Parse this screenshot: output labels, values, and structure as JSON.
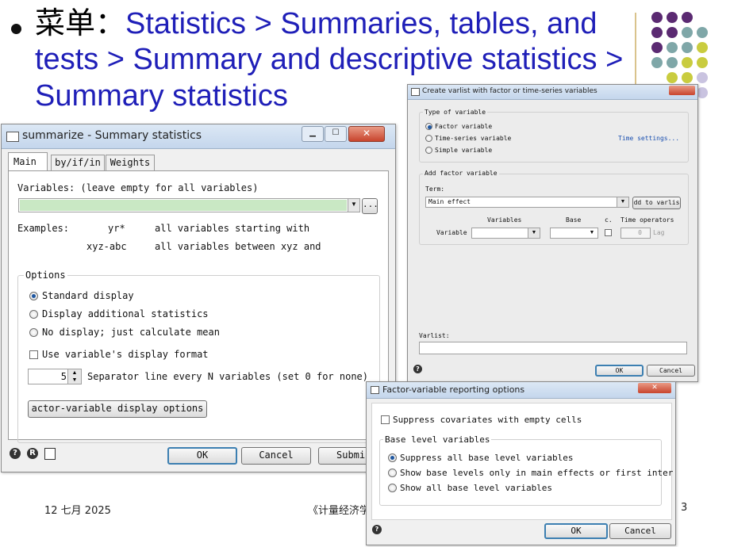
{
  "slide": {
    "title_prefix": "菜单：",
    "title_line1": "Statistics > Summaries, tables, and",
    "title_line2": "tests > Summary and descriptive statistics >",
    "title_line3": "Summary statistics",
    "footer_date": "12 七月 2025",
    "footer_center": "《计量经济学",
    "page_number": "3",
    "colors": {
      "title": "#1f1fb8",
      "dot_purple": "#5b2a72",
      "dot_teal": "#7fa7a8",
      "dot_yellow": "#c9cc3f",
      "dot_lavender": "#c9c3e0"
    }
  },
  "summarize": {
    "title": "summarize - Summary statistics",
    "tabs": [
      "Main",
      "by/if/in",
      "Weights"
    ],
    "variables_label": "Variables: (leave empty for all variables)",
    "browse_label": "...",
    "examples_label": "Examples:",
    "ex1_pattern": "yr*",
    "ex1_desc": "all variables starting with",
    "ex2_pattern": "xyz-abc",
    "ex2_desc": "all variables between xyz and",
    "options_label": "Options",
    "radio_standard": "Standard display",
    "radio_additional": "Display additional statistics",
    "radio_nodisplay": "No display; just calculate mean",
    "check_format": "Use variable's display format",
    "separator_value": "5",
    "separator_label": "Separator line every N variables (set 0 for none)",
    "factor_button": "actor-variable display options",
    "ok": "OK",
    "cancel": "Cancel",
    "submit": "Submi"
  },
  "varlist": {
    "title": "Create varlist with factor or time-series variables",
    "type_label": "Type of variable",
    "radio_factor": "Factor variable",
    "radio_timeseries": "Time-series variable",
    "radio_simple": "Simple variable",
    "time_settings": "Time settings...",
    "add_factor_label": "Add factor variable",
    "term_label": "Term:",
    "term_value": "Main effect",
    "add_button": "dd to varlis",
    "col_variables": "Variables",
    "col_base": "Base",
    "col_c": "c.",
    "col_time": "Time operators",
    "row_label": "Variable",
    "lag_value": "0",
    "lag_label": "Lag",
    "varlist_label": "Varlist:",
    "ok": "OK",
    "cancel": "Cancel"
  },
  "factor": {
    "title": "Factor-variable reporting options",
    "check_suppress": "Suppress covariates with empty cells",
    "base_label": "Base level variables",
    "radio_suppress_all": "Suppress all base level variables",
    "radio_show_main": "Show base levels only in main effects or first inter",
    "radio_show_all": "Show all base level variables",
    "ok": "OK",
    "cancel": "Cancel"
  }
}
